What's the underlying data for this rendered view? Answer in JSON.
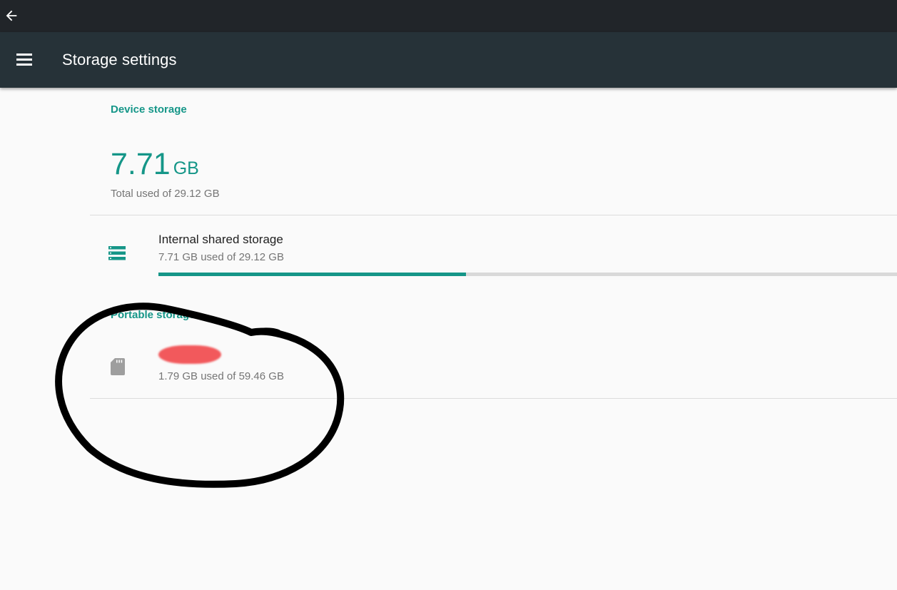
{
  "status_bar": {
    "back_icon": "arrow-back-icon"
  },
  "app_bar": {
    "menu_icon": "menu-icon",
    "title": "Storage settings"
  },
  "device_storage": {
    "header": "Device storage",
    "total_value": "7.71",
    "total_unit": "GB",
    "total_subtitle": "Total used of 29.12 GB",
    "internal": {
      "icon": "storage-icon",
      "title": "Internal shared storage",
      "subtitle": "7.71 GB used of 29.12 GB",
      "used_fraction": 0.265
    }
  },
  "portable_storage": {
    "header": "Portable storage",
    "sd_card": {
      "icon": "sd-card-icon",
      "title": "",
      "subtitle": "1.79 GB used of 59.46 GB"
    }
  },
  "colors": {
    "accent": "#159688",
    "app_bar": "#263238",
    "status_bar": "#212529",
    "background": "#fafafa",
    "annotation_ink": "#000000",
    "redaction": "#f2595c"
  }
}
